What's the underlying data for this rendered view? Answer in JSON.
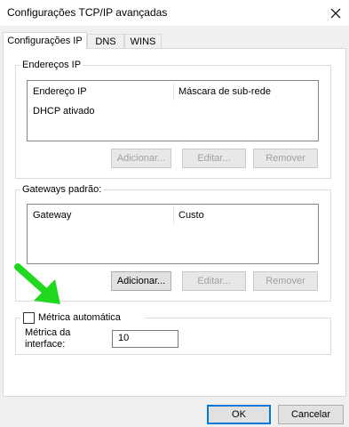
{
  "window": {
    "title": "Configurações TCP/IP avançadas",
    "close_icon": "close-icon"
  },
  "tabs": [
    {
      "label": "Configurações IP",
      "active": true
    },
    {
      "label": "DNS",
      "active": false
    },
    {
      "label": "WINS",
      "active": false
    }
  ],
  "ip_addresses": {
    "legend": "Endereços IP",
    "columns": [
      "Endereço IP",
      "Máscara de sub-rede"
    ],
    "rows": [
      {
        "address": "DHCP ativado",
        "mask": ""
      }
    ],
    "buttons": {
      "add": "Adicionar...",
      "edit": "Editar...",
      "remove": "Remover"
    }
  },
  "gateways": {
    "legend": "Gateways padrão:",
    "columns": [
      "Gateway",
      "Custo"
    ],
    "rows": [],
    "buttons": {
      "add": "Adicionar...",
      "edit": "Editar...",
      "remove": "Remover"
    }
  },
  "metric": {
    "auto_label": "Métrica automática",
    "auto_checked": false,
    "interface_label_line1": "Métrica da",
    "interface_label_line2": "interface:",
    "interface_value": "10"
  },
  "footer": {
    "ok": "OK",
    "cancel": "Cancelar"
  },
  "colors": {
    "annotation_arrow": "#1fd81f",
    "focus_border": "#0078d7",
    "disabled_text": "#a0a0a0"
  }
}
